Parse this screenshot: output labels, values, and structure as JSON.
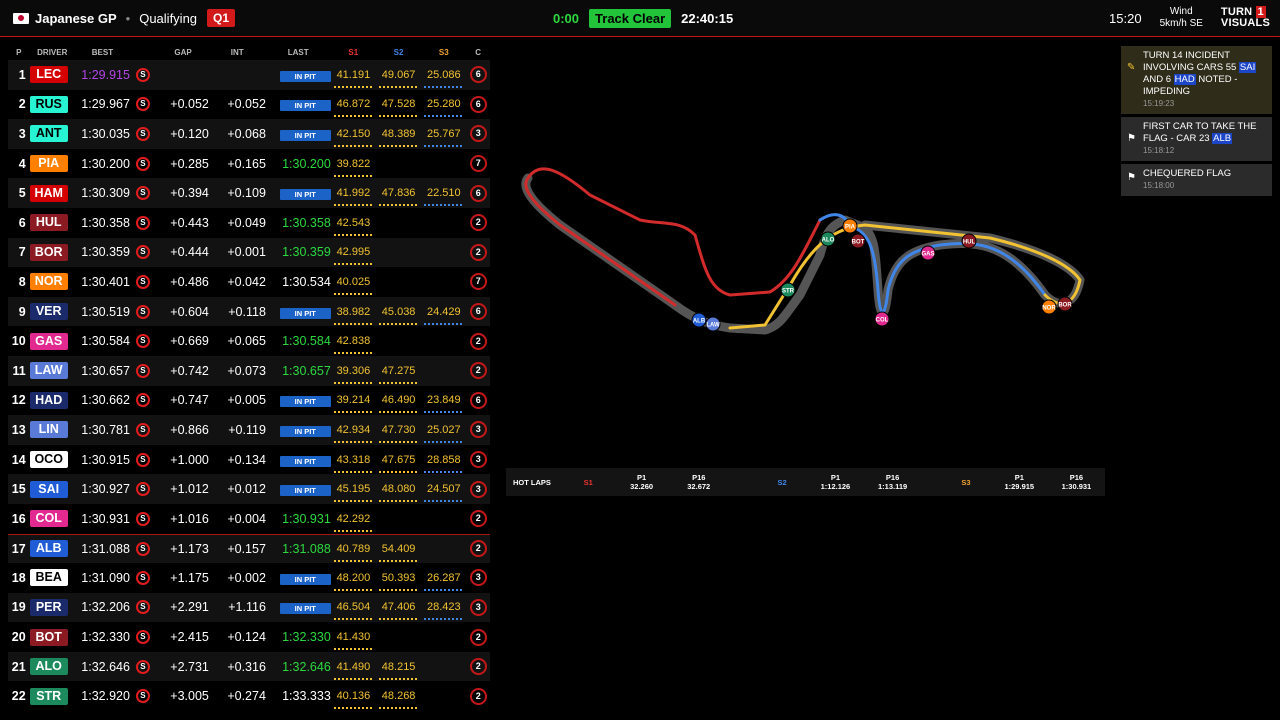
{
  "header": {
    "event": "Japanese GP",
    "session": "Qualifying",
    "session_badge": "Q1",
    "session_clock": "0:00",
    "track_status": "Track Clear",
    "time_of_day": "22:40:15",
    "local_time": "15:20",
    "wind_label": "Wind",
    "wind_value": "5km/h SE",
    "brand_line1": "TURN",
    "brand_num": "1",
    "brand_line2": "VISUALS"
  },
  "columns": [
    "P",
    "DRIVER",
    "BEST",
    "GAP",
    "INT",
    "LAST",
    "S1",
    "S2",
    "S3",
    "C"
  ],
  "drivers": [
    {
      "pos": "1",
      "tla": "LEC",
      "color": "#d40000",
      "best": "1:29.915",
      "best_fast": true,
      "tyre": "S",
      "gap": "",
      "int": "",
      "last": "IN PIT",
      "s1": "41.191",
      "s2": "49.067",
      "s3": "25.086",
      "laps": "6"
    },
    {
      "pos": "2",
      "tla": "RUS",
      "color": "#27f4d2",
      "dark": true,
      "best": "1:29.967",
      "tyre": "S",
      "gap": "+0.052",
      "int": "+0.052",
      "last": "IN PIT",
      "s1": "46.872",
      "s2": "47.528",
      "s3": "25.280",
      "laps": "6"
    },
    {
      "pos": "3",
      "tla": "ANT",
      "color": "#27f4d2",
      "dark": true,
      "best": "1:30.035",
      "tyre": "S",
      "gap": "+0.120",
      "int": "+0.068",
      "last": "IN PIT",
      "s1": "42.150",
      "s2": "48.389",
      "s3": "25.767",
      "laps": "3"
    },
    {
      "pos": "4",
      "tla": "PIA",
      "color": "#ff8000",
      "best": "1:30.200",
      "tyre": "S",
      "gap": "+0.285",
      "int": "+0.165",
      "last": "1:30.200",
      "last_green": true,
      "s1": "39.822",
      "s2": "",
      "s3": "",
      "laps": "7"
    },
    {
      "pos": "5",
      "tla": "HAM",
      "color": "#d40000",
      "best": "1:30.309",
      "tyre": "S",
      "gap": "+0.394",
      "int": "+0.109",
      "last": "IN PIT",
      "s1": "41.992",
      "s2": "47.836",
      "s3": "22.510",
      "laps": "6"
    },
    {
      "pos": "6",
      "tla": "HUL",
      "color": "#8b1a22",
      "best": "1:30.358",
      "tyre": "S",
      "gap": "+0.443",
      "int": "+0.049",
      "last": "1:30.358",
      "last_green": true,
      "s1": "42.543",
      "s2": "",
      "s3": "",
      "laps": "2"
    },
    {
      "pos": "7",
      "tla": "BOR",
      "color": "#8b1a22",
      "best": "1:30.359",
      "tyre": "S",
      "gap": "+0.444",
      "int": "+0.001",
      "last": "1:30.359",
      "last_green": true,
      "s1": "42.995",
      "s2": "",
      "s3": "",
      "laps": "2"
    },
    {
      "pos": "8",
      "tla": "NOR",
      "color": "#ff8000",
      "best": "1:30.401",
      "tyre": "S",
      "gap": "+0.486",
      "int": "+0.042",
      "last": "1:30.534",
      "s1": "40.025",
      "s2": "",
      "s3": "",
      "laps": "7"
    },
    {
      "pos": "9",
      "tla": "VER",
      "color": "#1b2a6b",
      "best": "1:30.519",
      "tyre": "S",
      "gap": "+0.604",
      "int": "+0.118",
      "last": "IN PIT",
      "s1": "38.982",
      "s2": "45.038",
      "s3": "24.429",
      "laps": "6"
    },
    {
      "pos": "10",
      "tla": "GAS",
      "color": "#e1298f",
      "best": "1:30.584",
      "tyre": "S",
      "gap": "+0.669",
      "int": "+0.065",
      "last": "1:30.584",
      "last_green": true,
      "s1": "42.838",
      "s2": "",
      "s3": "",
      "laps": "2"
    },
    {
      "pos": "11",
      "tla": "LAW",
      "color": "#5a7ad8",
      "best": "1:30.657",
      "tyre": "S",
      "gap": "+0.742",
      "int": "+0.073",
      "last": "1:30.657",
      "last_green": true,
      "s1": "39.306",
      "s2": "47.275",
      "s3": "",
      "laps": "2"
    },
    {
      "pos": "12",
      "tla": "HAD",
      "color": "#1b2a6b",
      "best": "1:30.662",
      "tyre": "S",
      "gap": "+0.747",
      "int": "+0.005",
      "last": "IN PIT",
      "s1": "39.214",
      "s2": "46.490",
      "s3": "23.849",
      "laps": "6"
    },
    {
      "pos": "13",
      "tla": "LIN",
      "color": "#5a7ad8",
      "best": "1:30.781",
      "tyre": "S",
      "gap": "+0.866",
      "int": "+0.119",
      "last": "IN PIT",
      "s1": "42.934",
      "s2": "47.730",
      "s3": "25.027",
      "laps": "3"
    },
    {
      "pos": "14",
      "tla": "OCO",
      "color": "#ffffff",
      "dark": true,
      "best": "1:30.915",
      "tyre": "S",
      "gap": "+1.000",
      "int": "+0.134",
      "last": "IN PIT",
      "s1": "43.318",
      "s2": "47.675",
      "s3": "28.858",
      "laps": "3"
    },
    {
      "pos": "15",
      "tla": "SAI",
      "color": "#1f5cd6",
      "best": "1:30.927",
      "tyre": "S",
      "gap": "+1.012",
      "int": "+0.012",
      "last": "IN PIT",
      "s1": "45.195",
      "s2": "48.080",
      "s3": "24.507",
      "laps": "3"
    },
    {
      "pos": "16",
      "tla": "COL",
      "color": "#e1298f",
      "best": "1:30.931",
      "tyre": "S",
      "gap": "+1.016",
      "int": "+0.004",
      "last": "1:30.931",
      "last_green": true,
      "s1": "42.292",
      "s2": "",
      "s3": "",
      "laps": "2"
    },
    {
      "pos": "17",
      "tla": "ALB",
      "color": "#1f5cd6",
      "best": "1:31.088",
      "tyre": "S",
      "gap": "+1.173",
      "int": "+0.157",
      "last": "1:31.088",
      "last_green": true,
      "s1": "40.789",
      "s2": "54.409",
      "s3": "",
      "laps": "2",
      "cut": true
    },
    {
      "pos": "18",
      "tla": "BEA",
      "color": "#ffffff",
      "dark": true,
      "best": "1:31.090",
      "tyre": "S",
      "gap": "+1.175",
      "int": "+0.002",
      "last": "IN PIT",
      "s1": "48.200",
      "s2": "50.393",
      "s3": "26.287",
      "laps": "3"
    },
    {
      "pos": "19",
      "tla": "PER",
      "color": "#1b2a6b",
      "best": "1:32.206",
      "tyre": "S",
      "gap": "+2.291",
      "int": "+1.116",
      "last": "IN PIT",
      "s1": "46.504",
      "s2": "47.406",
      "s3": "28.423",
      "laps": "3"
    },
    {
      "pos": "20",
      "tla": "BOT",
      "color": "#8b1a22",
      "best": "1:32.330",
      "tyre": "S",
      "gap": "+2.415",
      "int": "+0.124",
      "last": "1:32.330",
      "last_green": true,
      "s1": "41.430",
      "s2": "",
      "s3": "",
      "laps": "2"
    },
    {
      "pos": "21",
      "tla": "ALO",
      "color": "#1d8a5e",
      "best": "1:32.646",
      "tyre": "S",
      "gap": "+2.731",
      "int": "+0.316",
      "last": "1:32.646",
      "last_green": true,
      "s1": "41.490",
      "s2": "48.215",
      "s3": "",
      "laps": "2"
    },
    {
      "pos": "22",
      "tla": "STR",
      "color": "#1d8a5e",
      "best": "1:32.920",
      "tyre": "S",
      "gap": "+3.005",
      "int": "+0.274",
      "last": "1:33.333",
      "s1": "40.136",
      "s2": "48.268",
      "s3": "",
      "laps": "2"
    }
  ],
  "hot_laps": {
    "title": "HOT LAPS",
    "s1_label": "S1",
    "s2_label": "S2",
    "s3_label": "S3",
    "s1": [
      {
        "label": "P1",
        "time": "32.260"
      },
      {
        "label": "P16",
        "time": "32.672"
      }
    ],
    "s2": [
      {
        "label": "P1",
        "time": "1:12.126"
      },
      {
        "label": "P16",
        "time": "1:13.119"
      }
    ],
    "s3": [
      {
        "label": "P1",
        "time": "1:29.915"
      },
      {
        "label": "P16",
        "time": "1:30.931"
      }
    ]
  },
  "messages": [
    {
      "pre": "TURN 14 INCIDENT INVOLVING CARS 55 ",
      "hl1": "SAI",
      "mid": " AND 6 ",
      "hl2": "HAD",
      "post": " NOTED - IMPEDING",
      "time": "15:19:23",
      "icon": "pencil-icon"
    },
    {
      "pre": "FIRST CAR TO TAKE THE FLAG - CAR 23 ",
      "hl1": "ALB",
      "time": "15:18:12",
      "icon": "chequered-flag-icon"
    },
    {
      "pre": "CHEQUERED FLAG",
      "time": "15:18:00",
      "icon": "chequered-flag-icon"
    }
  ],
  "map_cars": [
    {
      "tla": "PIA",
      "color": "#ff8000"
    },
    {
      "tla": "BOT",
      "color": "#8b1a22"
    },
    {
      "tla": "ALO",
      "color": "#1d8a5e"
    },
    {
      "tla": "STR",
      "color": "#1d8a5e"
    },
    {
      "tla": "HUL",
      "color": "#8b1a22"
    },
    {
      "tla": "GAS",
      "color": "#e1298f"
    },
    {
      "tla": "COL",
      "color": "#e1298f"
    },
    {
      "tla": "NOR",
      "color": "#ff8000"
    },
    {
      "tla": "BOR",
      "color": "#8b1a22"
    },
    {
      "tla": "ALB",
      "color": "#1f5cd6"
    },
    {
      "tla": "LAW",
      "color": "#5a7ad8"
    }
  ]
}
